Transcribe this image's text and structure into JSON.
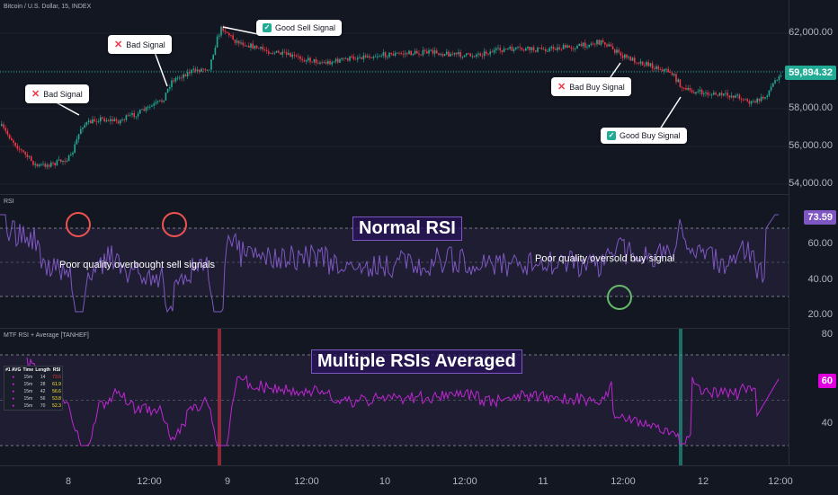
{
  "header": {
    "symbol_title": "Bitcoin / U.S. Dollar, 15, INDEX"
  },
  "rsi_pane": {
    "title": "RSI",
    "current_value": "73.59",
    "big_label": "Normal RSI",
    "annot_sell": "Poor quality overbought sell signals",
    "annot_buy": "Poor quality oversold buy signal",
    "axis": [
      "60.00",
      "40.00",
      "20.00"
    ]
  },
  "mtf_pane": {
    "title": "MTF RSI + Average [TANHEF]",
    "current_value": "60",
    "big_label": "Multiple RSIs Averaged",
    "axis": [
      "80",
      "40"
    ],
    "table": {
      "headers": [
        "#1 AVG",
        "Time",
        "Length",
        "RSI"
      ],
      "rows": [
        [
          "",
          "15m",
          "14",
          "73.6"
        ],
        [
          "",
          "15m",
          "28",
          "61.9"
        ],
        [
          "",
          "15m",
          "42",
          "56.6"
        ],
        [
          "",
          "15m",
          "56",
          "53.8"
        ],
        [
          "",
          "15m",
          "70",
          "52.3"
        ]
      ]
    }
  },
  "price_pane": {
    "current_price": "59,894.32",
    "axis": [
      "62,000.00",
      "60,000.00",
      "58,000.00",
      "56,000.00",
      "54,000.00"
    ],
    "callouts": {
      "bad1": "Bad Signal",
      "bad2": "Bad Signal",
      "good_sell": "Good Sell Signal",
      "bad_buy": "Bad Buy Signal",
      "good_buy": "Good Buy Signal"
    }
  },
  "time_axis": [
    "8",
    "12:00",
    "9",
    "12:00",
    "10",
    "12:00",
    "11",
    "12:00",
    "12",
    "12:00"
  ],
  "colors": {
    "up": "#22ab94",
    "down": "#f23645",
    "rsi": "#7e57c2",
    "mtf": "#c026d3",
    "background": "#131722"
  }
}
